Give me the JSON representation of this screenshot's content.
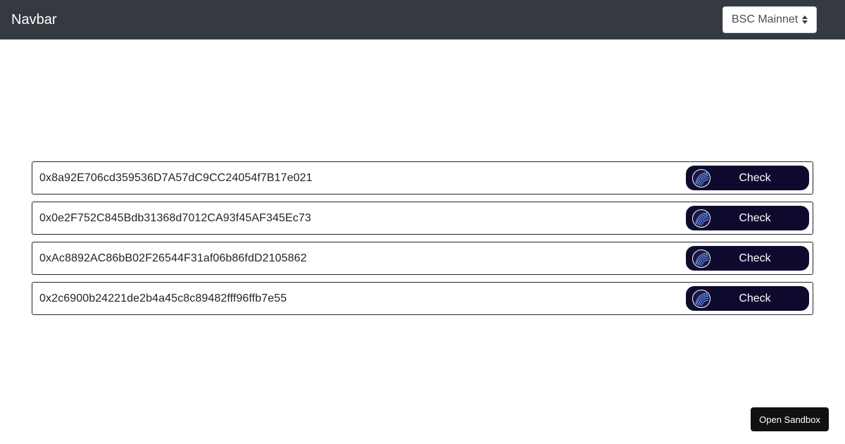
{
  "navbar": {
    "brand": "Navbar",
    "network_select": {
      "selected": "BSC Mainnet"
    }
  },
  "rows": [
    {
      "address": "0x8a92E706cd359536D7A57dC9CC24054f7B17e021",
      "button_label": "Check"
    },
    {
      "address": "0x0e2F752C845Bdb31368d7012CA93f45AF345Ec73",
      "button_label": "Check"
    },
    {
      "address": "0xAc8892AC86bB02F26544F31af06b86fdD2105862",
      "button_label": "Check"
    },
    {
      "address": "0x2c6900b24221de2b4a45c8c89482fff96ffb7e55",
      "button_label": "Check"
    }
  ],
  "sandbox": {
    "label": "Open Sandbox"
  },
  "icons": {
    "check_button_logo": "swirl-logo-icon",
    "select_arrows": "up-down-arrows-icon"
  },
  "colors": {
    "navbar_bg": "#343a40",
    "check_button_bg": "#0d0a2e",
    "sandbox_bg": "#111111"
  }
}
